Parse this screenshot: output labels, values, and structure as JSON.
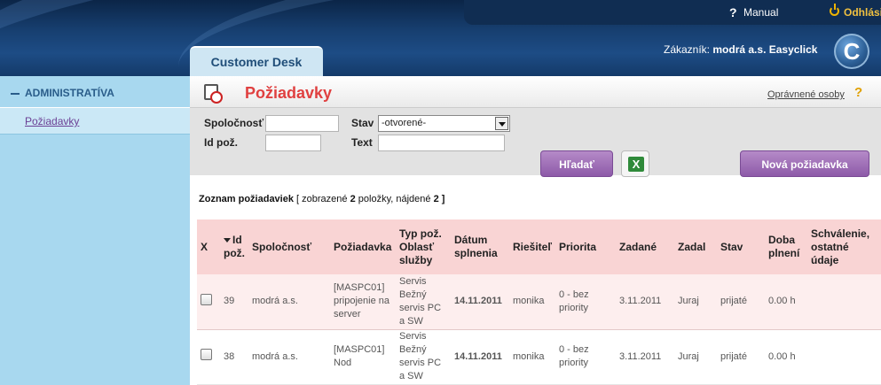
{
  "header": {
    "help_glyph": "?",
    "manual_label": "Manual",
    "logout_label": "Odhlásiť",
    "customer_prefix": "Zákazník:",
    "customer_name": "modrá a.s. Easyclick",
    "logo_letter": "C",
    "tab_label": "Customer Desk"
  },
  "sidebar": {
    "section_label": "ADMINISTRATÍVA",
    "items": [
      {
        "label": "Požiadavky"
      }
    ]
  },
  "main": {
    "title": "Požiadavky",
    "auth_link": "Oprávnené osoby",
    "help_glyph": "?"
  },
  "filter": {
    "company_label": "Spoločnosť",
    "company_value": "",
    "id_label": "Id pož.",
    "id_value": "",
    "state_label": "Stav",
    "state_value": "-otvorené-",
    "text_label": "Text",
    "text_value": "",
    "search_button": "Hľadať",
    "excel_glyph": "X",
    "new_button": "Nová požiadavka"
  },
  "list": {
    "title": "Zoznam požiadaviek",
    "summary_open": "[ zobrazené",
    "shown": "2",
    "summary_mid": "položky, nájdené",
    "found": "2",
    "summary_close": "]"
  },
  "table": {
    "columns": [
      "X",
      "Id pož.",
      "Spoločnosť",
      "Požiadavka",
      "Typ pož. Oblasť služby",
      "Dátum splnenia",
      "Riešiteľ",
      "Priorita",
      "Zadané",
      "Zadal",
      "Stav",
      "Doba plnení",
      "Schválenie, ostatné údaje"
    ],
    "rows": [
      {
        "id": "39",
        "company": "modrá a.s.",
        "request": "[MASPC01] pripojenie na server",
        "type": "Servis Bežný servis PC a SW",
        "due": "14.11.2011",
        "solver": "monika",
        "priority": "0 - bez priority",
        "created": "3.11.2011",
        "author": "Juraj",
        "state": "prijaté",
        "duration": "0.00 h",
        "approval": ""
      },
      {
        "id": "38",
        "company": "modrá a.s.",
        "request": "[MASPC01] Nod",
        "type": "Servis Bežný servis PC a SW",
        "due": "14.11.2011",
        "solver": "monika",
        "priority": "0 - bez priority",
        "created": "3.11.2011",
        "author": "Juraj",
        "state": "prijaté",
        "duration": "0.00 h",
        "approval": ""
      }
    ]
  }
}
